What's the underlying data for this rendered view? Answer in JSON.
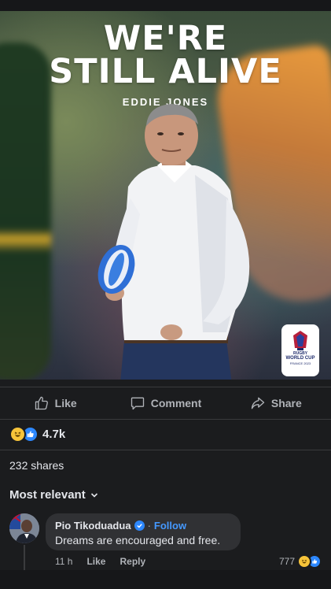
{
  "post_image": {
    "headline_line1": "WE'RE",
    "headline_line2": "STILL ALIVE",
    "subheadline": "EDDIE JONES",
    "logo": {
      "line1": "RUGBY",
      "line2": "WORLD CUP",
      "line3": "FRANCE 2023"
    }
  },
  "actions": {
    "like": "Like",
    "comment": "Comment",
    "share": "Share"
  },
  "reactions": {
    "types": [
      "haha-emoji",
      "like-emoji"
    ],
    "count": "4.7k"
  },
  "shares_count": "232 shares",
  "sort_label": "Most relevant",
  "comment": {
    "author": "Pio Tikoduadua",
    "separator": "·",
    "follow": "Follow",
    "text": "Dreams are encouraged and free.",
    "time": "11 h",
    "like": "Like",
    "reply": "Reply",
    "reaction_count": "777"
  },
  "colors": {
    "background": "#1b1c1e",
    "bubble": "#303134",
    "accent_blue": "#2d88ff",
    "muted_text": "#b0b3b8"
  }
}
